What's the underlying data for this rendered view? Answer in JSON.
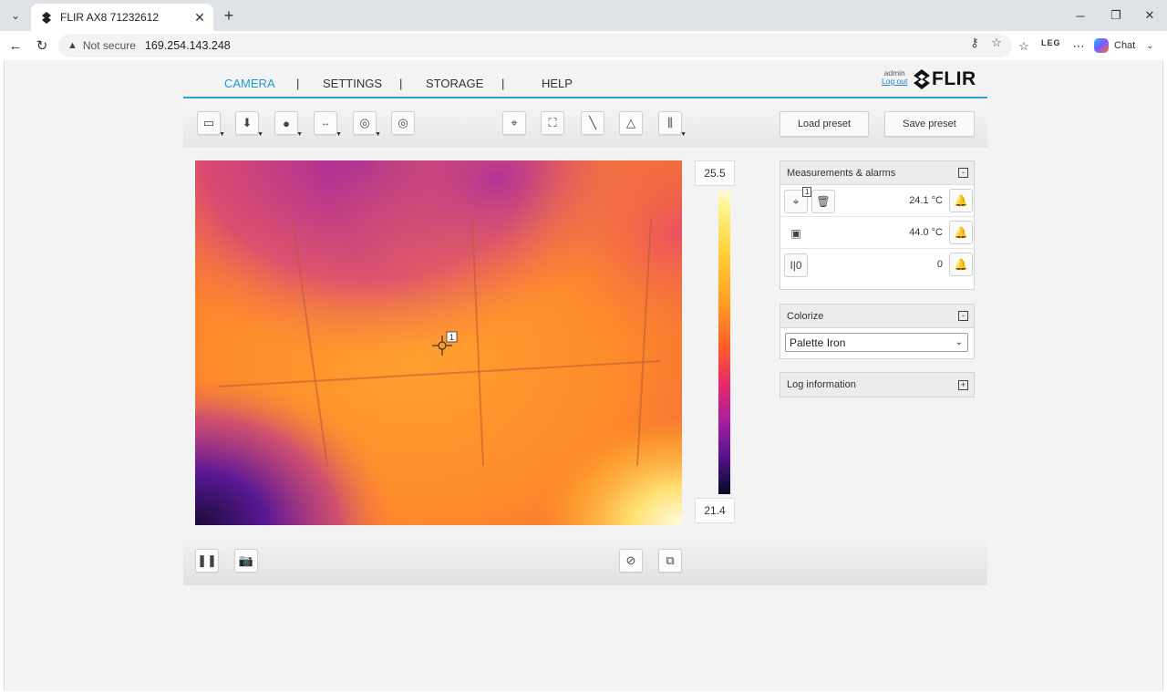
{
  "browser": {
    "tab_title": "FLIR AX8 71232612",
    "security_label": "Not secure",
    "url": "169.254.143.248",
    "chat_label": "Chat",
    "leg_label": "LEG"
  },
  "header": {
    "nav": [
      {
        "label": "CAMERA",
        "active": true
      },
      {
        "label": "SETTINGS",
        "active": false
      },
      {
        "label": "STORAGE",
        "active": false
      },
      {
        "label": "HELP",
        "active": false
      }
    ],
    "separator": "|",
    "user": "admin",
    "logout": "Log out",
    "logo_text": "FLIR"
  },
  "toolbar": {
    "load_preset": "Load preset",
    "save_preset": "Save preset",
    "tools": [
      "image-mode-icon",
      "focus-icon",
      "lamp-icon",
      "flip-icon",
      "shutter-icon",
      "nuc-icon",
      "spot-icon",
      "box-icon",
      "line-icon",
      "delta-icon",
      "adjust-icon"
    ]
  },
  "scale": {
    "max": "25.5",
    "min": "21.4"
  },
  "thermal": {
    "spot_label": "1",
    "palette_colors": [
      "#0a0820",
      "#5a1590",
      "#e8286a",
      "#ff9a1e",
      "#fff38a"
    ]
  },
  "measurements": {
    "title": "Measurements & alarms",
    "collapse": "-",
    "rows": [
      {
        "icon": "spot-icon",
        "badge": "1",
        "value": "24.1 °C"
      },
      {
        "icon": "box-temp-icon",
        "value": "44.0 °C"
      },
      {
        "icon": "digital-io-icon",
        "label": "I|0",
        "value": "0"
      }
    ]
  },
  "colorize": {
    "title": "Colorize",
    "collapse": "-",
    "selected": "Palette Iron"
  },
  "log": {
    "title": "Log information",
    "expand": "+"
  }
}
